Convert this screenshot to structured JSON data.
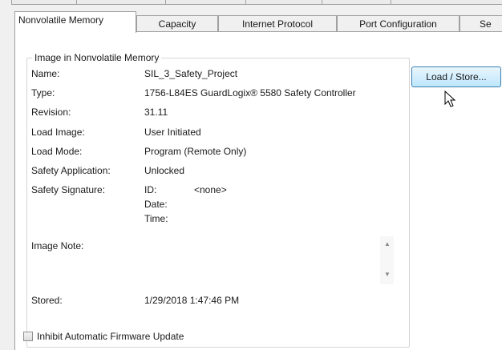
{
  "tabs": [
    {
      "label": "Nonvolatile Memory",
      "active": true
    },
    {
      "label": "Capacity"
    },
    {
      "label": "Internet Protocol"
    },
    {
      "label": "Port Configuration"
    },
    {
      "label": "Se"
    }
  ],
  "group": {
    "title": "Image in Nonvolatile Memory",
    "name_label": "Name:",
    "name_value": "SIL_3_Safety_Project",
    "type_label": "Type:",
    "type_value": "1756-L84ES GuardLogix® 5580 Safety Controller",
    "revision_label": "Revision:",
    "revision_value": "31.11",
    "load_image_label": "Load Image:",
    "load_image_value": "User Initiated",
    "load_mode_label": "Load Mode:",
    "load_mode_value": "Program (Remote Only)",
    "safety_app_label": "Safety Application:",
    "safety_app_value": "Unlocked",
    "safety_sig_label": "Safety Signature:",
    "sig_id_label": "ID:",
    "sig_id_value": "<none>",
    "sig_date_label": "Date:",
    "sig_time_label": "Time:",
    "image_note_label": "Image Note:",
    "stored_label": "Stored:",
    "stored_value": "1/29/2018  1:47:46 PM"
  },
  "load_store_button": "Load / Store...",
  "inhibit_checkbox": {
    "label": "Inhibit Automatic Firmware Update",
    "checked": false
  }
}
